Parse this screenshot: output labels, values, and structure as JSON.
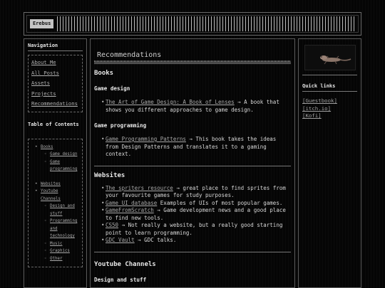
{
  "header": {
    "logo": "Erebus"
  },
  "nav": {
    "title": "Navigation",
    "items": [
      "About Me",
      "All Posts",
      "Assets",
      "Projects",
      "Recommendations"
    ]
  },
  "toc": {
    "title": "Table of Contents",
    "books": "Books",
    "books_children": [
      "Game design",
      "Game programming"
    ],
    "websites": "Websites",
    "youtube": "Youtube Channels",
    "youtube_children": [
      "Design and stuff",
      "Programming and technology",
      "Music",
      "Graphics",
      "Other"
    ]
  },
  "main": {
    "title": "Recommendations",
    "books_heading": "Books",
    "game_design_heading": "Game design",
    "game_design_items": [
      {
        "link": "The Art of Game Design: A Book of Lenses",
        "desc": " → A book that shows you different approaches to game design."
      }
    ],
    "game_programming_heading": "Game programming",
    "game_programming_items": [
      {
        "link": "Game Programming Patterns",
        "desc": " → This book takes the ideas from Design Patterns and translates it to a gaming context."
      }
    ],
    "websites_heading": "Websites",
    "websites_items": [
      {
        "link": "The spriters resource",
        "desc": " → great place to find sprites from your favourite games for study purposes."
      },
      {
        "link": "Game UI database",
        "desc": " Examples of UIs of most popular games."
      },
      {
        "link": "GameFromScratch",
        "desc": " → Game development news and a good place to find new tools."
      },
      {
        "link": "CS50",
        "desc": " → Not really a website, but a really good starting point to learn programming."
      },
      {
        "link": "GDC Vault",
        "desc": " → GDC talks."
      }
    ],
    "youtube_heading": "Youtube Channels",
    "design_heading": "Design and stuff"
  },
  "right": {
    "image_icon": "lizard-image",
    "quick_links_title": "Quick links",
    "links": [
      "[Guestbook]",
      "[itch.io]",
      "[Kofi]"
    ]
  }
}
